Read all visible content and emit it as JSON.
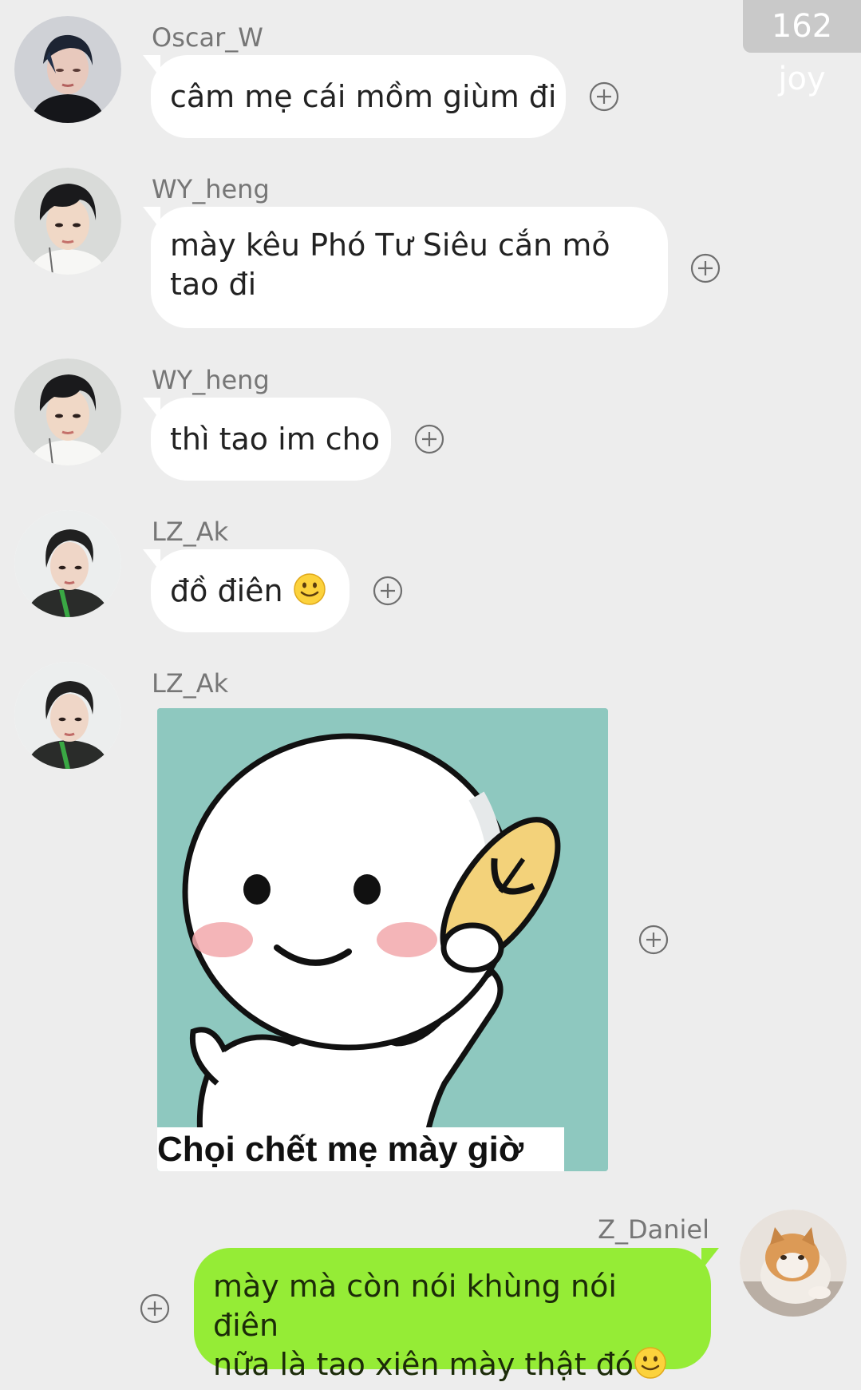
{
  "watermark": "162 joy",
  "messages": [
    {
      "sender": "Oscar_W",
      "text": "câm mẹ cái mồm giùm đi"
    },
    {
      "sender": "WY_heng",
      "line1": "mày kêu Phó Tư Siêu cắn mỏ",
      "line2": "tao đi"
    },
    {
      "sender": "WY_heng",
      "text": "thì tao im cho"
    },
    {
      "sender": "LZ_Ak",
      "text": "đồ điên"
    },
    {
      "sender": "LZ_Ak",
      "sticker_caption": "Chọi chết mẹ mày giờ"
    },
    {
      "sender": "Z_Daniel",
      "line1": "mày mà còn nói khùng nói điên",
      "line2": "nữa là tao xiên mày thật đó"
    }
  ],
  "icons": {
    "add": "plus-circle-icon",
    "emoji": "slightly-smiling-face-emoji"
  },
  "colors": {
    "background": "#ededed",
    "incoming_bubble": "#ffffff",
    "outgoing_bubble": "#95ec36",
    "sticker_bg": "#8ec8bf"
  }
}
